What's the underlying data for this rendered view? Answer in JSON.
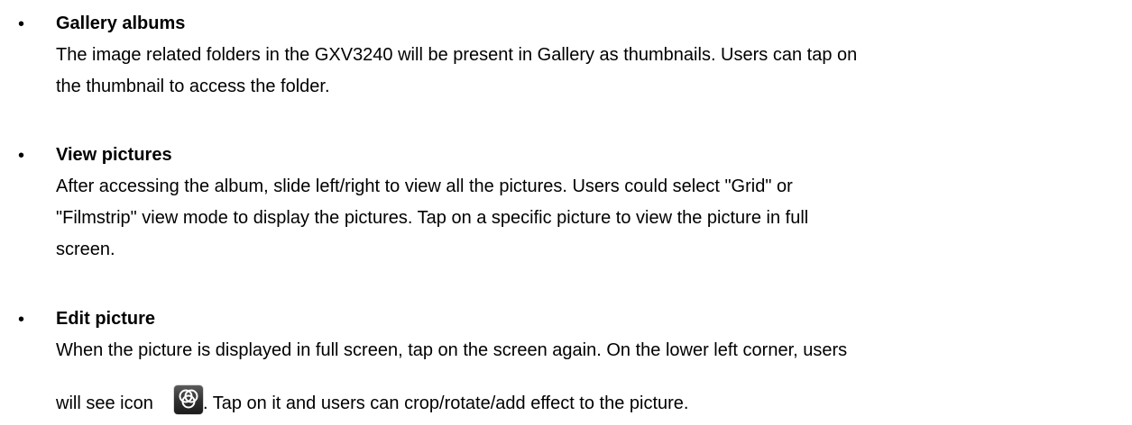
{
  "sections": [
    {
      "title": "Gallery albums",
      "lines": [
        "The image related folders in the GXV3240 will be present in Gallery as thumbnails. Users can tap on",
        "the thumbnail to access the folder."
      ]
    },
    {
      "title": "View pictures",
      "lines": [
        "After accessing the album, slide left/right to view all the pictures. Users could select \"Grid\" or",
        "\"Filmstrip\" view mode to display the pictures. Tap on a specific picture to view the picture in full",
        "screen."
      ]
    },
    {
      "title": "Edit picture",
      "lines": [
        "When the picture is displayed in full screen, tap on the screen again. On the lower left corner, users"
      ],
      "icon_line_before": "will see icon",
      "icon_line_after": ". Tap on it and users can crop/rotate/add effect to the picture."
    }
  ],
  "bullet_char": "•",
  "icon": "photo-effects-icon"
}
